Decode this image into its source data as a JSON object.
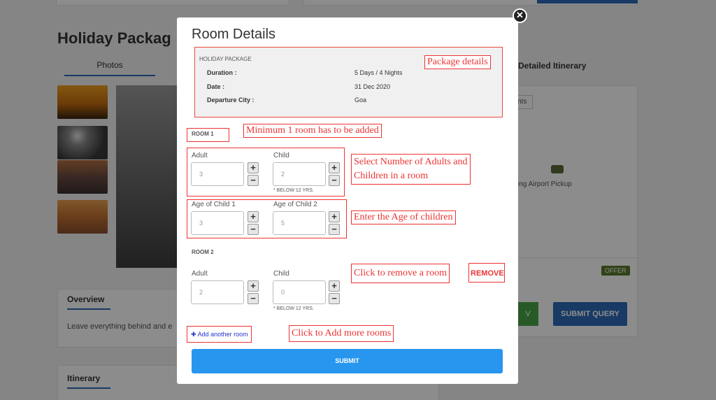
{
  "background": {
    "page_title": "Holiday Packag",
    "tab_photos": "Photos",
    "tab_itinerary": "Detailed Itinerary",
    "chip": "nts",
    "airport_label": "ing   Airport Pickup",
    "offer": "OFFER",
    "green_btn": "V",
    "submit_query": "SUBMIT QUERY",
    "overview": "Overview",
    "overview_text": "Leave everything behind and e",
    "itinerary": "Itinerary"
  },
  "modal": {
    "close_symbol": "✕",
    "title": "Room Details",
    "package": {
      "heading": "HOLIDAY PACKAGE",
      "duration_label": "Duration :",
      "duration_value": "5 Days / 4 Nights",
      "date_label": "Date :",
      "date_value": "31 Dec 2020",
      "city_label": "Departure City :",
      "city_value": "Goa"
    },
    "room1": {
      "label": "ROOM 1",
      "adult_label": "Adult",
      "adult_value": "3",
      "child_label": "Child",
      "child_value": "2",
      "child_note": "* BELOW 12 YRS.",
      "age1_label": "Age of Child 1",
      "age1_value": "3",
      "age2_label": "Age of Child 2",
      "age2_value": "5"
    },
    "room2": {
      "label": "ROOM 2",
      "adult_label": "Adult",
      "adult_value": "2",
      "child_label": "Child",
      "child_value": "0",
      "child_note": "* BELOW 12 YRS."
    },
    "plus": "+",
    "minus": "−",
    "add_room": "Add another room",
    "add_icon": "✚",
    "remove": "REMOVE",
    "submit": "SUBMIT"
  },
  "annotations": {
    "package_details": "Package details",
    "min_room": "Minimum 1 room has to be added",
    "select_line1": "Select Number of Adults and",
    "select_line2": "Children in a room",
    "age": "Enter the Age of children",
    "remove_room": "Click to remove a room",
    "add_more": "Click to Add more rooms"
  },
  "colors": {
    "accent_blue": "#2896ee",
    "annotation_red": "#e33"
  }
}
